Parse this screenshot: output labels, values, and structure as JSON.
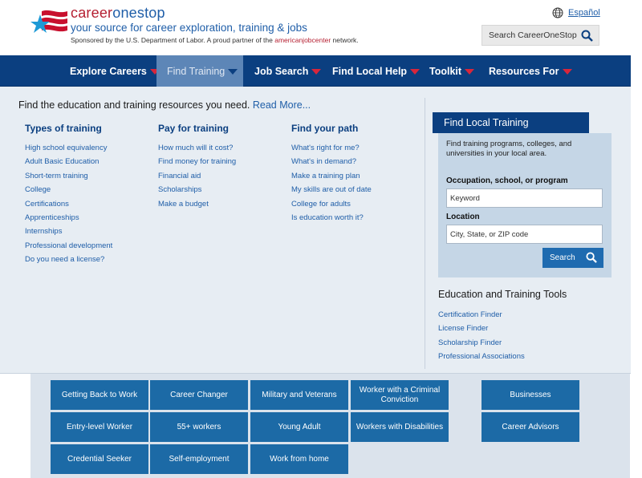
{
  "header": {
    "brand_a": "career",
    "brand_b": "onestop",
    "tagline": "your source for career exploration, training & jobs",
    "sponsor_pre": "Sponsored by the U.S. Department of Labor. A proud partner of the ",
    "sponsor_ajc": "americanjobcenter",
    "sponsor_post": " network.",
    "language_link": "Español",
    "search_label": "Search CareerOneStop"
  },
  "nav": {
    "items": [
      {
        "label": "Explore Careers"
      },
      {
        "label": "Find Training"
      },
      {
        "label": "Job Search"
      },
      {
        "label": "Find Local Help"
      },
      {
        "label": "Toolkit"
      },
      {
        "label": "Resources For"
      }
    ]
  },
  "dropdown": {
    "intro_text": "Find the education and training resources you need.",
    "intro_link": "Read More...",
    "columns": [
      {
        "title": "Types of training",
        "links": [
          "High school equivalency",
          "Adult Basic Education",
          "Short-term training",
          "College",
          "Certifications",
          "Apprenticeships",
          "Internships",
          "Professional development",
          "Do you need a license?"
        ]
      },
      {
        "title": "Pay for training",
        "links": [
          "How much will it cost?",
          "Find money for training",
          "Financial aid",
          "Scholarships",
          "Make a budget"
        ]
      },
      {
        "title": "Find your path",
        "links": [
          "What's right for me?",
          "What's in demand?",
          "Make a training plan",
          "My skills are out of date",
          "College for adults",
          "Is education worth it?"
        ]
      }
    ],
    "local_training": {
      "title": "Find Local Training",
      "description": "Find training programs, colleges, and universities in your local area.",
      "occupation_label": "Occupation, school, or program",
      "occupation_placeholder": "Keyword",
      "location_label": "Location",
      "location_placeholder": "City, State, or ZIP code",
      "search_button": "Search"
    },
    "tools": {
      "title": "Education and Training Tools",
      "links": [
        "Certification Finder",
        "License Finder",
        "Scholarship Finder",
        "Professional Associations"
      ]
    }
  },
  "audience_tiles": [
    "Getting Back to Work",
    "Career Changer",
    "Military and Veterans",
    "Worker with a Criminal Conviction",
    "Entry-level Worker",
    "55+ workers",
    "Young Adult",
    "Workers with Disabilities",
    "Credential Seeker",
    "Self-employment",
    "Work from home",
    "Businesses",
    "Career Advisors"
  ],
  "colors": {
    "nav_blue": "#0b3f80",
    "active_tab": "#5d86b7",
    "brand_red": "#b51f31",
    "link_blue": "#1f5ea8",
    "tile_blue": "#1c6aa6"
  }
}
